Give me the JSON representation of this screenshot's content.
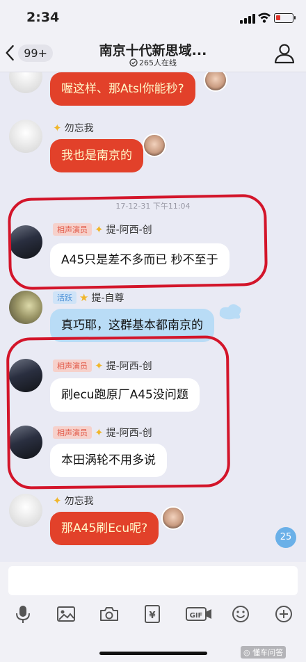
{
  "status": {
    "time": "2:34"
  },
  "header": {
    "back_count": "99+",
    "title": "南京十代新思域...",
    "online": "265人在线"
  },
  "messages": {
    "m0": {
      "text": "喔这样、那Atsl你能秒?"
    },
    "m1": {
      "name": "勿忘我",
      "text": "我也是南京的"
    },
    "time_divider": "17-12-31 下午11:04",
    "m2": {
      "tag": "相声演员",
      "name": "提-阿西-创",
      "text": "A45只是差不多而已 秒不至于"
    },
    "m3": {
      "tag": "活跃",
      "name": "提-自尊",
      "text": "真巧耶，这群基本都南京的"
    },
    "m4": {
      "tag": "相声演员",
      "name": "提-阿西-创",
      "text": "刷ecu跑原厂A45没问题"
    },
    "m5": {
      "tag": "相声演员",
      "name": "提-阿西-创",
      "text": "本田涡轮不用多说"
    },
    "m6": {
      "name": "勿忘我",
      "text": "那A45刷Ecu呢?"
    }
  },
  "unread_count": "25",
  "input": {
    "placeholder": ""
  },
  "toolbar": {
    "gif": "GIF",
    "money": "¥"
  },
  "watermark": "◎ 懂车问答",
  "colors": {
    "red_bubble": "#e2412a",
    "blue_bubble": "#b9dcf6",
    "annotation_red": "#d3152a",
    "accent_blue": "#6ab0e8"
  }
}
